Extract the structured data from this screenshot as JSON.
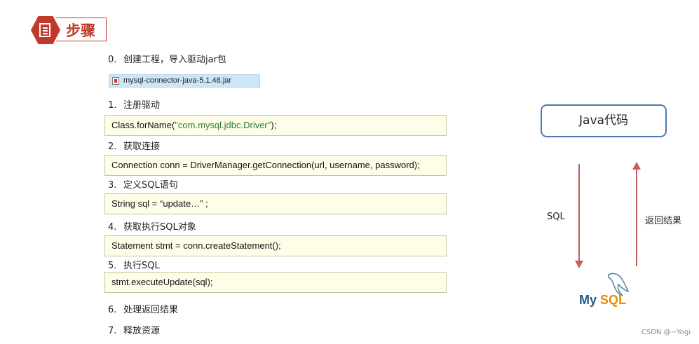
{
  "header": {
    "title": "步骤"
  },
  "steps": [
    {
      "num": "0.",
      "text": "创建工程，导入驱动jar包"
    },
    {
      "num": "1.",
      "text": "注册驱动"
    },
    {
      "num": "2.",
      "text": "获取连接"
    },
    {
      "num": "3.",
      "text": "定义SQL语句"
    },
    {
      "num": "4.",
      "text": "获取执行SQL对象"
    },
    {
      "num": "5.",
      "text": "执行SQL"
    },
    {
      "num": "6.",
      "text": "处理返回结果"
    },
    {
      "num": "7.",
      "text": "释放资源"
    }
  ],
  "jar_file": "mysql-connector-java-5.1.48.jar",
  "code": {
    "register_prefix": "Class.forName(",
    "register_string": "\"com.mysql.jdbc.Driver\"",
    "register_suffix": ");",
    "connection": "Connection conn = DriverManager.getConnection(url, username, password);",
    "sql": "String sql =  “update…” ;",
    "statement": "Statement stmt = conn.createStatement();",
    "execute": "stmt.executeUpdate(sql);"
  },
  "diagram": {
    "java_box": "Java代码",
    "left_arrow_label": "SQL",
    "right_arrow_label": "返回结果",
    "logo_text_my": "My",
    "logo_text_sql": "SQL",
    "arrow_color": "#c65c5c",
    "box_border_color": "#4a7ab7"
  },
  "watermark": "CSDN @~Yogi"
}
